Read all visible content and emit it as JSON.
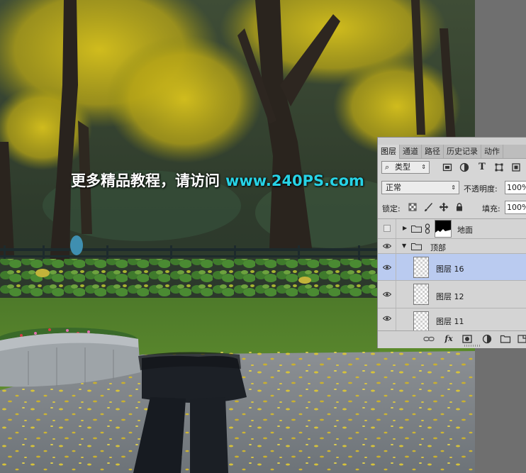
{
  "watermark": {
    "text_cn": "更多精品教程，请访问",
    "url": "www.240PS.com",
    "url_color": "#27d3e6"
  },
  "layers_panel": {
    "tabs": [
      {
        "label": "图层",
        "active": true
      },
      {
        "label": "通道",
        "active": false
      },
      {
        "label": "路径",
        "active": false
      },
      {
        "label": "历史记录",
        "active": false
      },
      {
        "label": "动作",
        "active": false
      }
    ],
    "filter": {
      "value": "类型",
      "icon": "search-icon"
    },
    "filter_icons": [
      "image-filter-icon",
      "adjustment-filter-icon",
      "type-filter-icon",
      "shape-filter-icon",
      "smart-object-filter-icon"
    ],
    "blend_mode": "正常",
    "opacity_label": "不透明度:",
    "opacity_value": "100%",
    "lock_label": "锁定:",
    "lock_icons": [
      "lock-transparent-icon",
      "lock-image-icon",
      "lock-position-icon",
      "lock-all-icon"
    ],
    "fill_label": "填充:",
    "fill_value": "100%",
    "layers": [
      {
        "name": "地面",
        "type": "group",
        "visible": false,
        "expanded": false,
        "has_mask": true
      },
      {
        "name": "顶部",
        "type": "group",
        "visible": true,
        "expanded": true
      },
      {
        "name": "图层 16",
        "type": "layer",
        "visible": true,
        "selected": true
      },
      {
        "name": "图层 12",
        "type": "layer",
        "visible": true,
        "selected": false
      },
      {
        "name": "图层 11",
        "type": "layer",
        "visible": true,
        "selected": false
      }
    ],
    "bottom_icons": [
      "link-icon",
      "fx-icon",
      "mask-icon",
      "adjustment-icon",
      "new-group-icon",
      "new-layer-icon"
    ],
    "selected_color": "#bacbf0"
  }
}
